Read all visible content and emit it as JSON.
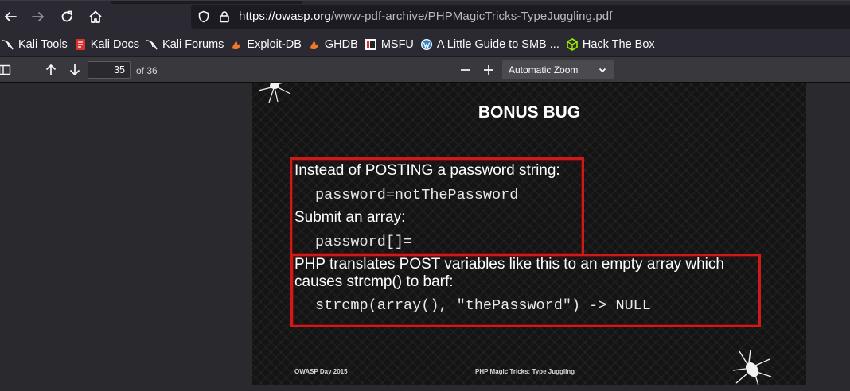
{
  "browser": {
    "url_host": "https://owasp.org",
    "url_path": "/www-pdf-archive/PHPMagicTricks-TypeJuggling.pdf",
    "icons": [
      "back-icon",
      "forward-icon",
      "reload-icon",
      "home-icon",
      "shield-icon",
      "lock-icon"
    ]
  },
  "bookmarks": [
    {
      "label": "Kali Tools",
      "icon": "kali-dragon-icon"
    },
    {
      "label": "Kali Docs",
      "icon": "kali-docs-icon"
    },
    {
      "label": "Kali Forums",
      "icon": "kali-dragon-icon"
    },
    {
      "label": "Exploit-DB",
      "icon": "exploit-db-icon"
    },
    {
      "label": "GHDB",
      "icon": "ghdb-icon"
    },
    {
      "label": "MSFU",
      "icon": "msfu-icon"
    },
    {
      "label": "A Little Guide to SMB ...",
      "icon": "wordpress-icon"
    },
    {
      "label": "Hack The Box",
      "icon": "hack-the-box-icon"
    }
  ],
  "pdf_toolbar": {
    "page_number": "35",
    "page_count": "of 36",
    "zoom": "Automatic Zoom"
  },
  "slide": {
    "title": "BONUS BUG",
    "line1": "Instead of POSTING a password string:",
    "code1": "password=notThePassword",
    "line2": "Submit an array:",
    "code2": "password[]=",
    "line3a": "PHP translates POST variables like this to an empty array which",
    "line3b": "causes strcmp() to barf:",
    "code3": "strcmp(array(), \"thePassword\") -> NULL",
    "footer_left": "OWASP Day 2015",
    "footer_mid": "PHP Magic Tricks: Type Juggling"
  },
  "colors": {
    "highlight_border": "#d01919",
    "slide_background": "#141414",
    "toolbar_background": "#2b2a33"
  }
}
